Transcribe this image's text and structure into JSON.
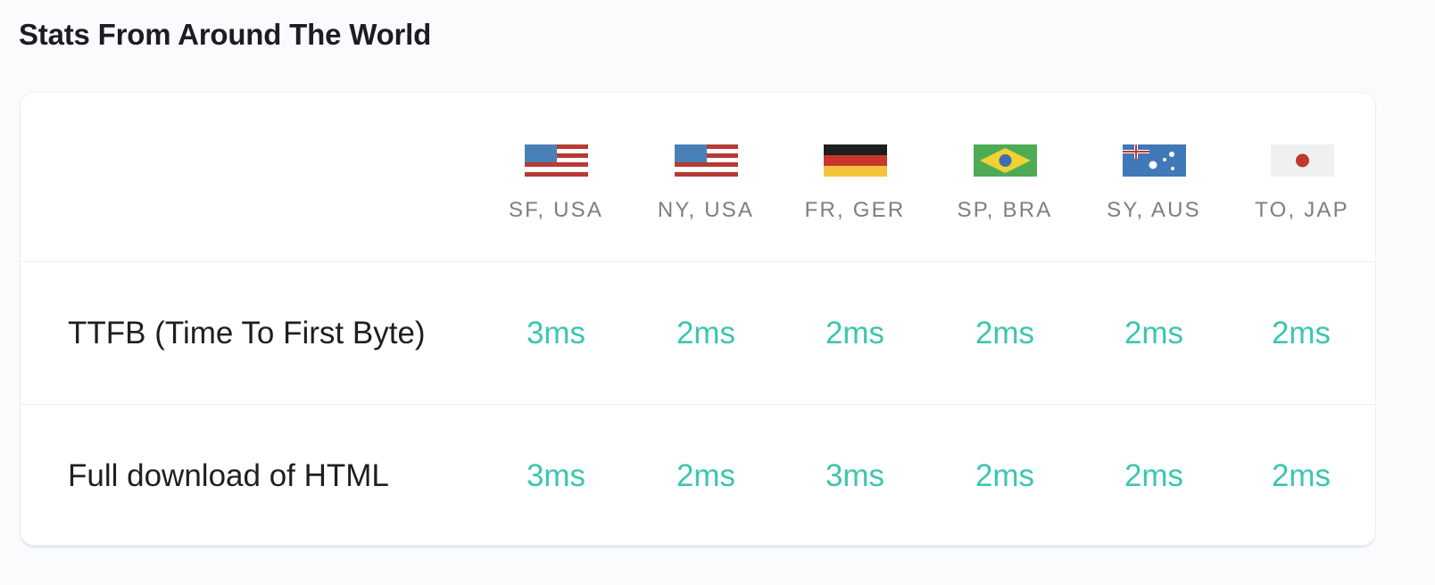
{
  "title": "Stats From Around The World",
  "locations": [
    {
      "label": "SF, USA",
      "flag": "us-flag-icon"
    },
    {
      "label": "NY, USA",
      "flag": "us-flag-icon"
    },
    {
      "label": "FR, GER",
      "flag": "germany-flag-icon"
    },
    {
      "label": "SP, BRA",
      "flag": "brazil-flag-icon"
    },
    {
      "label": "SY, AUS",
      "flag": "australia-flag-icon"
    },
    {
      "label": "TO, JAP",
      "flag": "japan-flag-icon"
    }
  ],
  "metrics": [
    {
      "label": "TTFB (Time To First Byte)",
      "values": [
        "3ms",
        "2ms",
        "2ms",
        "2ms",
        "2ms",
        "2ms"
      ]
    },
    {
      "label": "Full download of HTML",
      "values": [
        "3ms",
        "2ms",
        "3ms",
        "2ms",
        "2ms",
        "2ms"
      ]
    }
  ],
  "colors": {
    "value_accent": "#3cc6ae",
    "title_text": "#1b1d21",
    "city_text": "#7b7e85",
    "page_background": "#fafbfd",
    "card_background": "#ffffff"
  }
}
